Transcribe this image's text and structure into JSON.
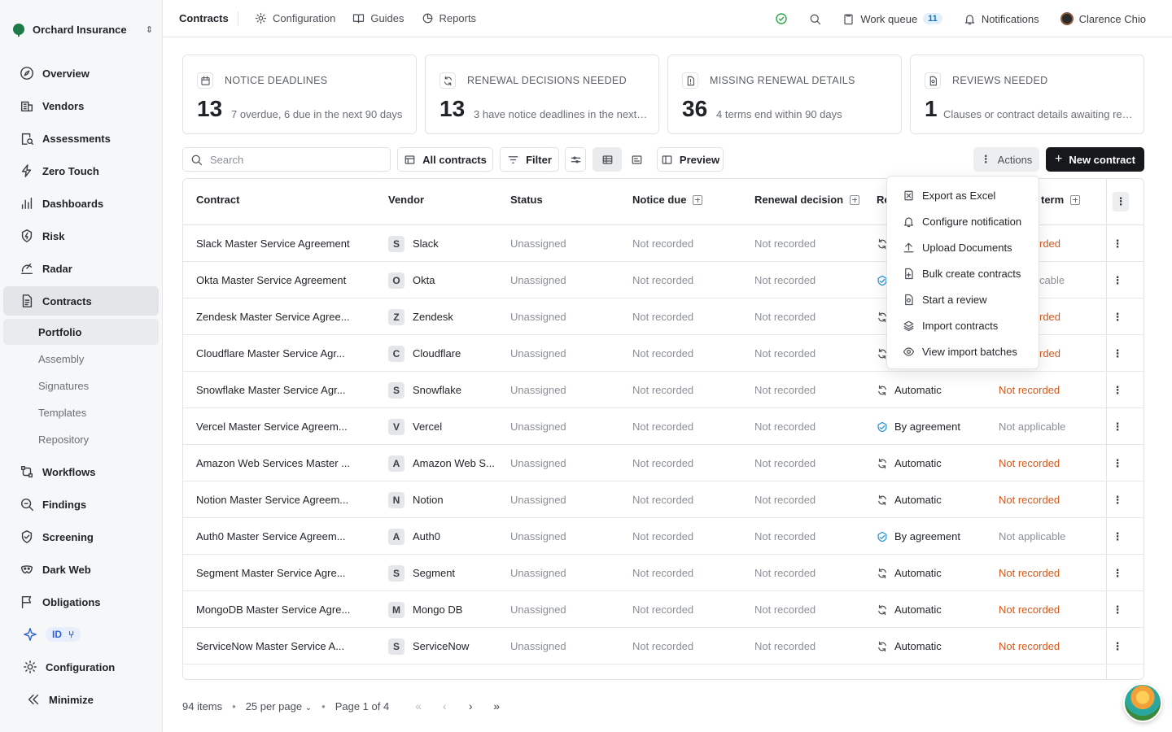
{
  "org": {
    "name": "Orchard Insurance"
  },
  "sidebar": {
    "items": [
      {
        "label": "Overview",
        "icon": "compass-icon"
      },
      {
        "label": "Vendors",
        "icon": "building-icon"
      },
      {
        "label": "Assessments",
        "icon": "document-search-icon"
      },
      {
        "label": "Zero Touch",
        "icon": "lightning-icon"
      },
      {
        "label": "Dashboards",
        "icon": "bar-chart-icon"
      },
      {
        "label": "Risk",
        "icon": "shield-bolt-icon"
      },
      {
        "label": "Radar",
        "icon": "radar-icon"
      },
      {
        "label": "Contracts",
        "icon": "contract-icon"
      }
    ],
    "contracts_sub": [
      "Portfolio",
      "Assembly",
      "Signatures",
      "Templates",
      "Repository"
    ],
    "items2": [
      {
        "label": "Workflows",
        "icon": "workflow-icon"
      },
      {
        "label": "Findings",
        "icon": "magnifier-icon"
      },
      {
        "label": "Screening",
        "icon": "shield-check-icon"
      },
      {
        "label": "Dark Web",
        "icon": "mask-icon"
      },
      {
        "label": "Obligations",
        "icon": "flag-icon"
      }
    ],
    "id_badge": "ID",
    "configuration": "Configuration",
    "minimize": "Minimize"
  },
  "topbar": {
    "breadcrumb": "Contracts",
    "links": [
      "Configuration",
      "Guides",
      "Reports"
    ],
    "work_queue": "Work queue",
    "work_queue_count": "11",
    "notifications": "Notifications",
    "user": "Clarence Chio"
  },
  "stats": [
    {
      "title": "NOTICE DEADLINES",
      "value": "13",
      "desc": "7 overdue, 6 due in the next 90 days"
    },
    {
      "title": "RENEWAL DECISIONS NEEDED",
      "value": "13",
      "desc": "3 have notice deadlines in the next…"
    },
    {
      "title": "MISSING RENEWAL DETAILS",
      "value": "36",
      "desc": "4 terms end within 90 days"
    },
    {
      "title": "REVIEWS NEEDED",
      "value": "1",
      "desc": "Clauses or contract details awaiting re…"
    }
  ],
  "toolbar": {
    "search_placeholder": "Search",
    "all_contracts": "All contracts",
    "filter": "Filter",
    "preview": "Preview",
    "actions": "Actions",
    "new_contract": "New contract"
  },
  "table": {
    "headers": [
      "Contract",
      "Vendor",
      "Status",
      "Notice due",
      "Renewal decision",
      "Re",
      "term"
    ],
    "rows": [
      {
        "contract": "Slack Master Service Agreement",
        "vendor": "Slack",
        "initial": "S",
        "status": "Unassigned",
        "notice": "Not recorded",
        "renewal": "Not recorded",
        "type": "",
        "term": "rded",
        "term_style": "red"
      },
      {
        "contract": "Okta Master Service Agreement",
        "vendor": "Okta",
        "initial": "O",
        "status": "Unassigned",
        "notice": "Not recorded",
        "renewal": "Not recorded",
        "type": "",
        "term": "cable",
        "term_style": "gray"
      },
      {
        "contract": "Zendesk Master Service Agree...",
        "vendor": "Zendesk",
        "initial": "Z",
        "status": "Unassigned",
        "notice": "Not recorded",
        "renewal": "Not recorded",
        "type": "",
        "term": "rded",
        "term_style": "red"
      },
      {
        "contract": "Cloudflare Master Service Agr...",
        "vendor": "Cloudflare",
        "initial": "C",
        "status": "Unassigned",
        "notice": "Not recorded",
        "renewal": "Not recorded",
        "type": "",
        "term": "rded",
        "term_style": "red"
      },
      {
        "contract": "Snowflake Master Service Agr...",
        "vendor": "Snowflake",
        "initial": "S",
        "status": "Unassigned",
        "notice": "Not recorded",
        "renewal": "Not recorded",
        "type": "Automatic",
        "term": "Not recorded",
        "term_style": "red"
      },
      {
        "contract": "Vercel Master Service Agreem...",
        "vendor": "Vercel",
        "initial": "V",
        "status": "Unassigned",
        "notice": "Not recorded",
        "renewal": "Not recorded",
        "type": "By agreement",
        "term": "Not applicable",
        "term_style": "gray"
      },
      {
        "contract": "Amazon Web Services Master ...",
        "vendor": "Amazon Web S...",
        "initial": "A",
        "status": "Unassigned",
        "notice": "Not recorded",
        "renewal": "Not recorded",
        "type": "Automatic",
        "term": "Not recorded",
        "term_style": "red"
      },
      {
        "contract": "Notion Master Service Agreem...",
        "vendor": "Notion",
        "initial": "N",
        "status": "Unassigned",
        "notice": "Not recorded",
        "renewal": "Not recorded",
        "type": "Automatic",
        "term": "Not recorded",
        "term_style": "red"
      },
      {
        "contract": "Auth0 Master Service Agreem...",
        "vendor": "Auth0",
        "initial": "A",
        "status": "Unassigned",
        "notice": "Not recorded",
        "renewal": "Not recorded",
        "type": "By agreement",
        "term": "Not applicable",
        "term_style": "gray"
      },
      {
        "contract": "Segment Master Service Agre...",
        "vendor": "Segment",
        "initial": "S",
        "status": "Unassigned",
        "notice": "Not recorded",
        "renewal": "Not recorded",
        "type": "Automatic",
        "term": "Not recorded",
        "term_style": "red"
      },
      {
        "contract": "MongoDB Master Service Agre...",
        "vendor": "Mongo DB",
        "initial": "M",
        "status": "Unassigned",
        "notice": "Not recorded",
        "renewal": "Not recorded",
        "type": "Automatic",
        "term": "Not recorded",
        "term_style": "red"
      },
      {
        "contract": "ServiceNow Master Service A...",
        "vendor": "ServiceNow",
        "initial": "S",
        "status": "Unassigned",
        "notice": "Not recorded",
        "renewal": "Not recorded",
        "type": "Automatic",
        "term": "Not recorded",
        "term_style": "red"
      }
    ]
  },
  "actions_menu": [
    {
      "label": "Export as Excel",
      "icon": "excel-icon"
    },
    {
      "label": "Configure notification",
      "icon": "bell-icon"
    },
    {
      "label": "Upload Documents",
      "icon": "upload-icon"
    },
    {
      "label": "Bulk create contracts",
      "icon": "file-plus-icon"
    },
    {
      "label": "Start a review",
      "icon": "review-icon"
    },
    {
      "label": "Import contracts",
      "icon": "layers-icon"
    },
    {
      "label": "View import batches",
      "icon": "eye-icon"
    }
  ],
  "footer": {
    "items": "94 items",
    "per_page": "25 per page",
    "page": "Page 1 of 4"
  },
  "colors": {
    "accent_dark": "#16181b",
    "not_recorded": "#d35a1e",
    "agreement": "#1b8fd8",
    "check": "#2fa84f"
  }
}
